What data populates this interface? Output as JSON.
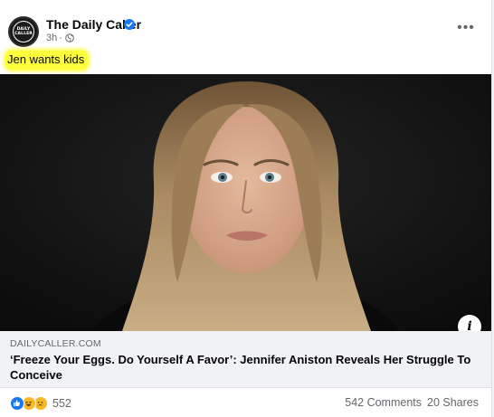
{
  "post": {
    "page_name": "The Daily Caller",
    "timestamp": "3h",
    "separator": "·",
    "avatar_text_line1": "DAILY",
    "avatar_text_line2": "CALLER",
    "verified_icon": "verified-badge-icon",
    "audience_icon": "globe-icon",
    "more_icon": "more-options-icon",
    "more_label": "•••",
    "caption": "Jen wants kids",
    "highlight_color": "#fdff3c"
  },
  "link": {
    "domain": "DAILYCALLER.COM",
    "title": "‘Freeze Your Eggs. Do Yourself A Favor’: Jennifer Aniston Reveals Her Struggle To Conceive",
    "info_label": "i",
    "photo_description_icon": "article-photo"
  },
  "engagement": {
    "reaction_icons": [
      "like-icon",
      "haha-icon",
      "sad-icon"
    ],
    "reaction_count": "552",
    "comments": "542 Comments",
    "shares": "20 Shares"
  },
  "colors": {
    "like_blue": "#1877f2",
    "reaction_yellow": "#f7b928",
    "secondary_text": "#65676b",
    "preview_bg": "#f0f2f5"
  }
}
